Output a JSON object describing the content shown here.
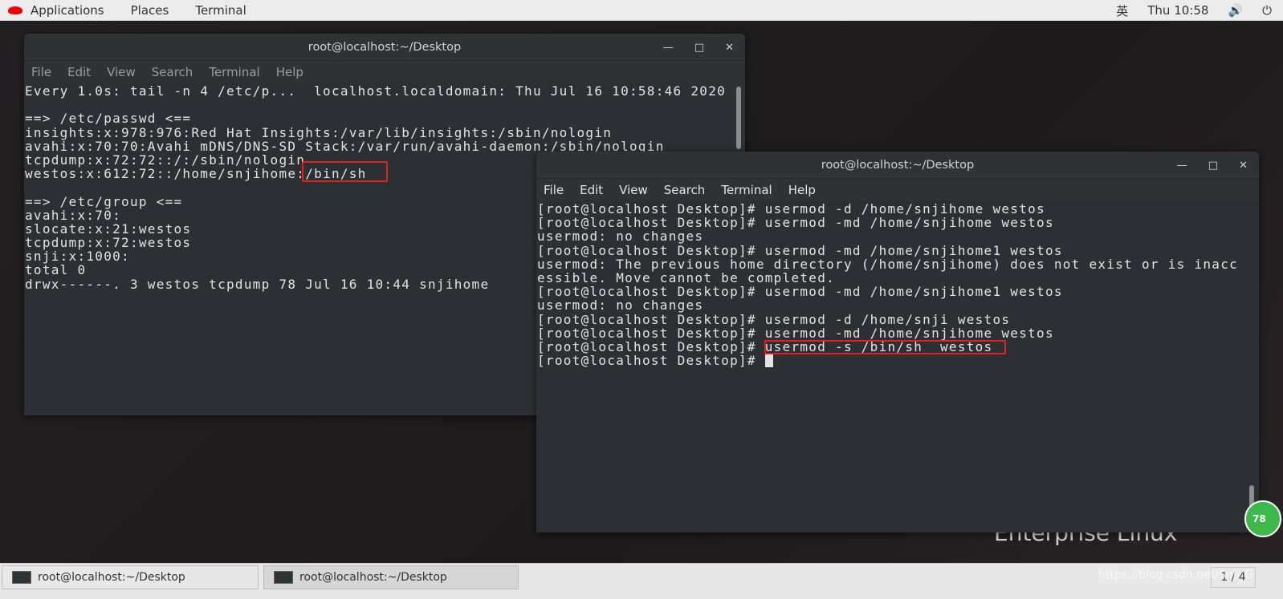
{
  "topbar": {
    "applications": "Applications",
    "places": "Places",
    "terminal": "Terminal",
    "input_method": "英",
    "clock": "Thu 10:58",
    "volume_icon": "volume-icon",
    "power_icon": "power-icon"
  },
  "desktop": {
    "background_text": "Enterprise Linux",
    "badge": "78"
  },
  "window1": {
    "title": "root@localhost:~/Desktop",
    "menu": [
      "File",
      "Edit",
      "View",
      "Search",
      "Terminal",
      "Help"
    ],
    "lines": [
      "Every 1.0s: tail -n 4 /etc/p...  localhost.localdomain: Thu Jul 16 10:58:46 2020",
      "",
      "==> /etc/passwd <==",
      "insights:x:978:976:Red Hat Insights:/var/lib/insights:/sbin/nologin",
      "avahi:x:70:70:Avahi mDNS/DNS-SD Stack:/var/run/avahi-daemon:/sbin/nologin",
      "tcpdump:x:72:72::/:/sbin/nologin",
      "westos:x:612:72::/home/snjihome:/bin/sh",
      "",
      "==> /etc/group <==",
      "avahi:x:70:",
      "slocate:x:21:westos",
      "tcpdump:x:72:westos",
      "snji:x:1000:",
      "total 0",
      "drwx------. 3 westos tcpdump 78 Jul 16 10:44 snjihome"
    ]
  },
  "window2": {
    "title": "root@localhost:~/Desktop",
    "menu": [
      "File",
      "Edit",
      "View",
      "Search",
      "Terminal",
      "Help"
    ],
    "lines": [
      "[root@localhost Desktop]# usermod -d /home/snjihome westos",
      "[root@localhost Desktop]# usermod -md /home/snjihome westos",
      "usermod: no changes",
      "[root@localhost Desktop]# usermod -md /home/snjihome1 westos",
      "usermod: The previous home directory (/home/snjihome) does not exist or is inacc",
      "essible. Move cannot be completed.",
      "[root@localhost Desktop]# usermod -md /home/snjihome1 westos",
      "usermod: no changes",
      "[root@localhost Desktop]# usermod -d /home/snji westos",
      "[root@localhost Desktop]# usermod -md /home/snjihome westos",
      "[root@localhost Desktop]# usermod -s /bin/sh  westos",
      "[root@localhost Desktop]# "
    ]
  },
  "taskbar": {
    "tasks": [
      "root@localhost:~/Desktop",
      "root@localhost:~/Desktop"
    ],
    "watermark": "https://blog.csdn.net/Snji_G",
    "pager": "1 / 4"
  }
}
